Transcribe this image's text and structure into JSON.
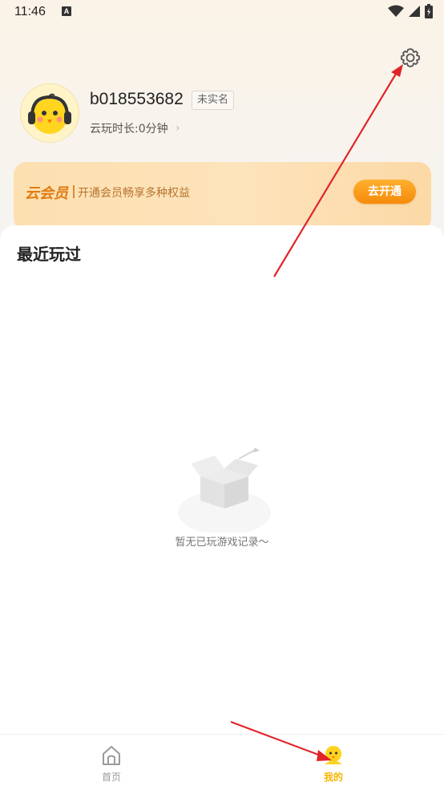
{
  "status_bar": {
    "time": "11:46",
    "notification_icon": "a-letter-icon",
    "icons": [
      "wifi-icon",
      "signal-icon",
      "battery-icon"
    ]
  },
  "header": {
    "settings_icon": "gear-icon"
  },
  "profile": {
    "username": "b018553682",
    "badge": "未实名",
    "playtime": "云玩时长:0分钟",
    "playtime_chevron": "›"
  },
  "vip": {
    "title": "云会员",
    "description": "开通会员畅享多种权益",
    "button": "去开通"
  },
  "recent": {
    "title": "最近玩过",
    "empty_text": "暂无已玩游戏记录～"
  },
  "tabs": [
    {
      "label": "首页",
      "icon": "home-icon",
      "active": false
    },
    {
      "label": "我的",
      "icon": "profile-icon",
      "active": true
    }
  ],
  "colors": {
    "accent": "#f5b500",
    "vip_orange": "#f58a0b",
    "annotation_red": "#e0252a"
  }
}
